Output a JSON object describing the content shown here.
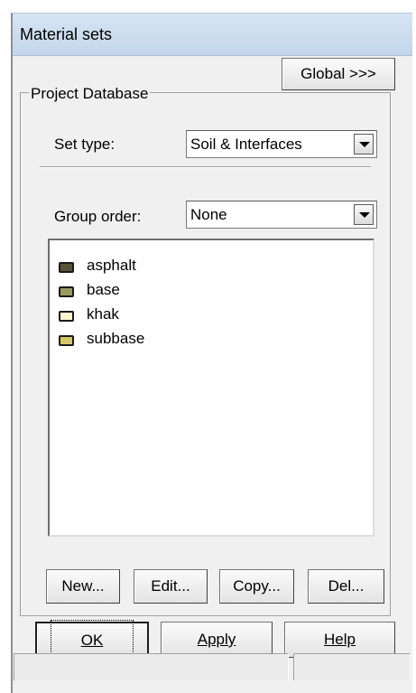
{
  "window": {
    "title": "Material sets"
  },
  "toolbar": {
    "global_label": "Global >>>"
  },
  "project_database": {
    "group_label": "Project Database",
    "set_type": {
      "label": "Set type:",
      "value": "Soil & Interfaces"
    },
    "group_order": {
      "label": "Group order:",
      "value": "None"
    },
    "materials": [
      {
        "name": "asphalt",
        "color": "#5a5238"
      },
      {
        "name": "base",
        "color": "#9a9a60"
      },
      {
        "name": "khak",
        "color": "#fbf5cf"
      },
      {
        "name": "subbase",
        "color": "#d6c66a"
      }
    ],
    "buttons": {
      "new": "New...",
      "edit": "Edit...",
      "copy": "Copy...",
      "del": "Del..."
    }
  },
  "dialog_buttons": {
    "ok": "OK",
    "apply": "Apply",
    "help": "Help"
  },
  "status_bar": {
    "left": "",
    "right": ""
  }
}
